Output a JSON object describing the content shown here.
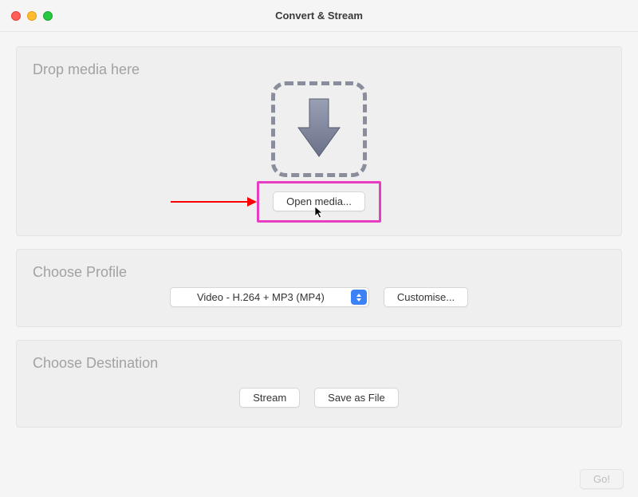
{
  "window": {
    "title": "Convert & Stream"
  },
  "drop": {
    "title": "Drop media here",
    "open_media_label": "Open media..."
  },
  "profile": {
    "title": "Choose Profile",
    "selected": "Video - H.264 + MP3 (MP4)",
    "customise_label": "Customise..."
  },
  "destination": {
    "title": "Choose Destination",
    "stream_label": "Stream",
    "save_label": "Save as File"
  },
  "footer": {
    "go_label": "Go!"
  }
}
